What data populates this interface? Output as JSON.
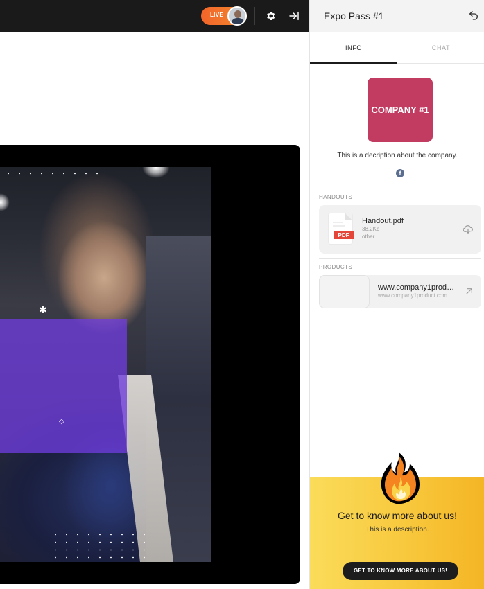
{
  "topbar": {
    "live_label": "LIVE",
    "settings_icon": "gear-icon",
    "collapse_icon": "arrow-right-to-bar-icon"
  },
  "sidebar": {
    "title": "Expo Pass #1",
    "back_icon": "undo-arrow-icon",
    "tabs": [
      {
        "label": "INFO",
        "active": true
      },
      {
        "label": "CHAT",
        "active": false
      }
    ],
    "company": {
      "logo_text": "COMPANY #1",
      "logo_color": "#c23c62",
      "description": "This is a decription about the company.",
      "social_icon": "facebook-icon"
    },
    "handouts": {
      "label": "HANDOUTS",
      "items": [
        {
          "name": "Handout.pdf",
          "size": "38.2Kb",
          "type": "other",
          "badge": "PDF"
        }
      ]
    },
    "products": {
      "label": "PRODUCTS",
      "items": [
        {
          "name": "www.company1product.com",
          "url": "www.company1product.com"
        }
      ]
    },
    "promo": {
      "title": "Get to know more about us!",
      "description": "This is a description.",
      "button_label": "GET TO KNOW MORE ABOUT US!",
      "icon": "fire-icon"
    }
  },
  "colors": {
    "live_pill": "#f3652a",
    "promo_bg": "#f8c63a",
    "overlay": "#6e3cdc"
  }
}
